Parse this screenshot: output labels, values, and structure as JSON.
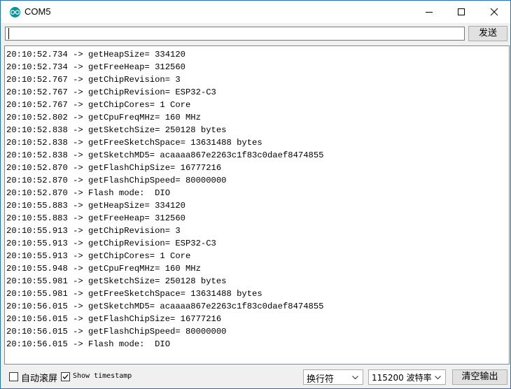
{
  "window": {
    "title": "COM5"
  },
  "input": {
    "value": "",
    "send_label": "发送"
  },
  "output_lines": [
    "20:10:52.734 -> getHeapSize= 334120",
    "20:10:52.734 -> getFreeHeap= 312560",
    "20:10:52.767 -> getChipRevision= 3",
    "20:10:52.767 -> getChipRevision= ESP32-C3",
    "20:10:52.767 -> getChipCores= 1 Core",
    "20:10:52.802 -> getCpuFreqMHz= 160 MHz",
    "20:10:52.838 -> getSketchSize= 250128 bytes",
    "20:10:52.838 -> getFreeSketchSpace= 13631488 bytes",
    "20:10:52.838 -> getSketchMD5= acaaaa867e2263c1f83c0daef8474855",
    "20:10:52.870 -> getFlashChipSize= 16777216",
    "20:10:52.870 -> getFlashChipSpeed= 80000000",
    "20:10:52.870 -> Flash mode:  DIO",
    "20:10:55.883 -> getHeapSize= 334120",
    "20:10:55.883 -> getFreeHeap= 312560",
    "20:10:55.913 -> getChipRevision= 3",
    "20:10:55.913 -> getChipRevision= ESP32-C3",
    "20:10:55.913 -> getChipCores= 1 Core",
    "20:10:55.948 -> getCpuFreqMHz= 160 MHz",
    "20:10:55.981 -> getSketchSize= 250128 bytes",
    "20:10:55.981 -> getFreeSketchSpace= 13631488 bytes",
    "20:10:56.015 -> getSketchMD5= acaaaa867e2263c1f83c0daef8474855",
    "20:10:56.015 -> getFlashChipSize= 16777216",
    "20:10:56.015 -> getFlashChipSpeed= 80000000",
    "20:10:56.015 -> Flash mode:  DIO"
  ],
  "footer": {
    "autoscroll_label": "自动滚屏",
    "autoscroll_checked": false,
    "timestamp_label": "Show timestamp",
    "timestamp_checked": true,
    "line_ending_selected": "换行符",
    "baud_selected": "115200 波特率",
    "clear_label": "清空输出"
  },
  "colors": {
    "accent": "#00979c",
    "window_border": "#1a73c8"
  },
  "icons": {
    "app": "arduino-infinity-icon",
    "minimize": "minimize-icon",
    "maximize": "maximize-icon",
    "close": "close-icon",
    "dropdown": "chevron-down-icon",
    "check": "checkmark-icon"
  }
}
